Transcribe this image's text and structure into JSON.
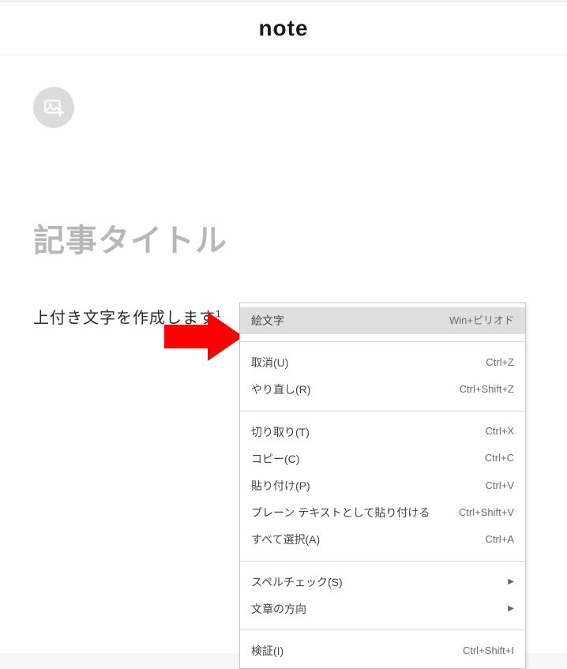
{
  "header": {
    "brand": "note"
  },
  "editor": {
    "title_placeholder": "記事タイトル",
    "body_text": "上付き文字を作成します",
    "body_sup": "1"
  },
  "context_menu": {
    "items": [
      {
        "label": "絵文字",
        "shortcut": "Win+ピリオド",
        "highlight": true
      },
      {
        "sep": true
      },
      {
        "label": "取消(U)",
        "shortcut": "Ctrl+Z"
      },
      {
        "label": "やり直し(R)",
        "shortcut": "Ctrl+Shift+Z"
      },
      {
        "sep": true
      },
      {
        "label": "切り取り(T)",
        "shortcut": "Ctrl+X"
      },
      {
        "label": "コピー(C)",
        "shortcut": "Ctrl+C"
      },
      {
        "label": "貼り付け(P)",
        "shortcut": "Ctrl+V"
      },
      {
        "label": "プレーン テキストとして貼り付ける",
        "shortcut": "Ctrl+Shift+V"
      },
      {
        "label": "すべて選択(A)",
        "shortcut": "Ctrl+A"
      },
      {
        "sep": true
      },
      {
        "label": "スペルチェック(S)",
        "submenu": true
      },
      {
        "label": "文章の方向",
        "submenu": true
      },
      {
        "sep": true
      },
      {
        "label": "検証(I)",
        "shortcut": "Ctrl+Shift+I"
      }
    ]
  },
  "icons": {
    "image_add": "image-add-icon",
    "submenu_arrow": "▶"
  }
}
